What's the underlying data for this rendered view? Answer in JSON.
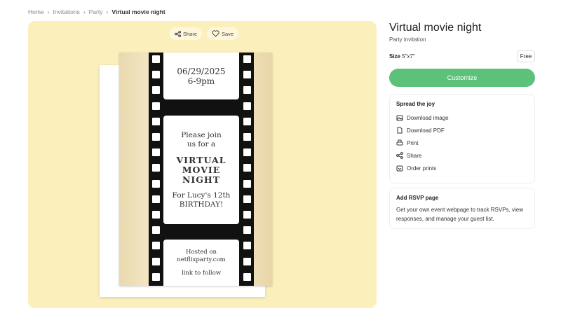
{
  "breadcrumb": [
    "Home",
    "Invitations",
    "Party",
    "Virtual movie night"
  ],
  "preview": {
    "share": "Share",
    "save": "Save",
    "card": {
      "date": "06/29/2025",
      "time": "6-9pm",
      "join1": "Please join",
      "join2": "us for a",
      "title1": "VIRTUAL",
      "title2": "MOVIE",
      "title3": "NIGHT",
      "for1": "For Lucy's 12th",
      "for2": "BIRTHDAY!",
      "host1": "Hosted on",
      "host2": "netflixparty.com",
      "link": "link to follow"
    }
  },
  "product": {
    "title": "Virtual movie night",
    "subtitle": "Party invitation",
    "size_label": "Size",
    "size_value": "5\"x7\"",
    "price": "Free",
    "customize": "Customize"
  },
  "spread": {
    "heading": "Spread the joy",
    "items": [
      {
        "label": "Download image",
        "icon": "image-download-icon"
      },
      {
        "label": "Download PDF",
        "icon": "pdf-download-icon"
      },
      {
        "label": "Print",
        "icon": "printer-icon"
      },
      {
        "label": "Share",
        "icon": "share-icon"
      },
      {
        "label": "Order prints",
        "icon": "order-prints-icon"
      }
    ]
  },
  "rsvp": {
    "heading": "Add RSVP page",
    "text": "Get your own event webpage to track RSVPs, view responses, and manage your guest list."
  },
  "colors": {
    "accent": "#5cc27a",
    "preview_bg": "#fbefbc"
  }
}
